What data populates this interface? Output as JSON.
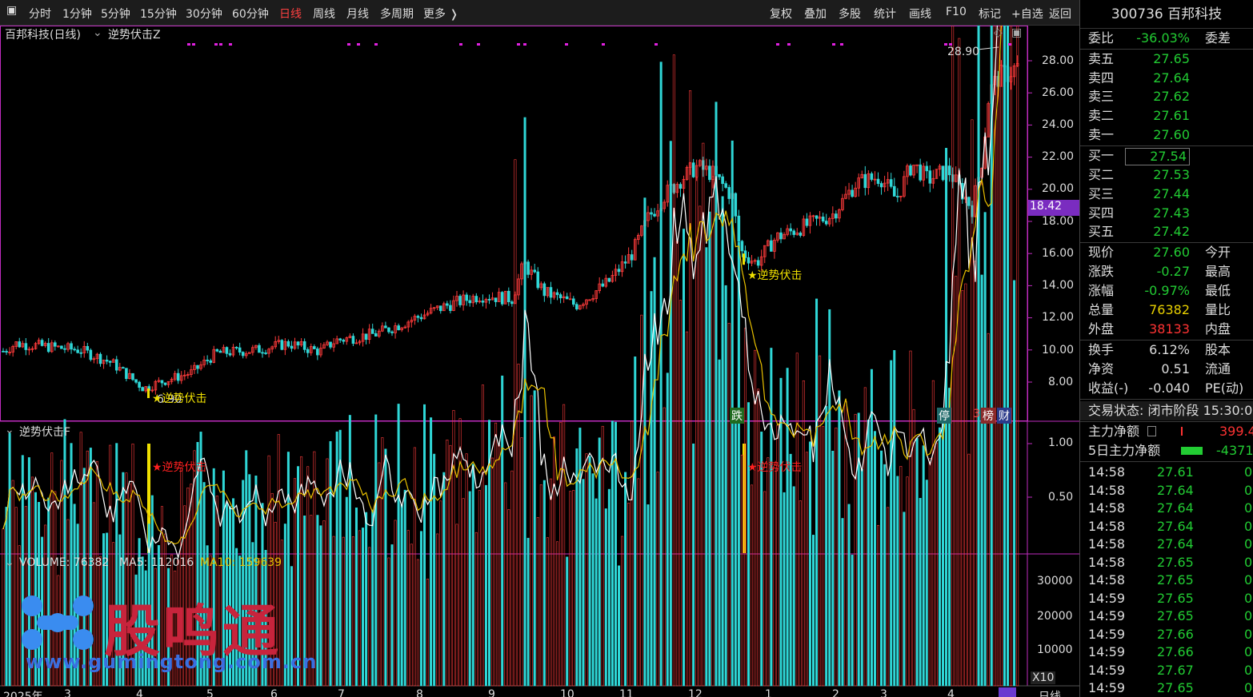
{
  "toolbar": {
    "menu_icon": "menu-icon",
    "periods": [
      "分时",
      "1分钟",
      "5分钟",
      "15分钟",
      "30分钟",
      "60分钟",
      "日线",
      "周线",
      "月线",
      "多周期",
      "更多 ❭"
    ],
    "active_period": "日线",
    "right_buttons": [
      "复权",
      "叠加",
      "多股",
      "统计",
      "画线",
      "F10",
      "标记",
      "+自选",
      "返回"
    ]
  },
  "chart_title": "百邦科技(日线)",
  "indicator_main": "逆势伏击Z",
  "indicator_sub": "逆势伏击F",
  "signal_label": "★逆势伏击",
  "high_label": "28.90",
  "low_label": "6.90",
  "current_price_tag": "18.42",
  "price_axis": [
    "28.00",
    "26.00",
    "24.00",
    "22.00",
    "20.00",
    "18.00",
    "16.00",
    "14.00",
    "12.00",
    "10.00",
    "8.00"
  ],
  "sub_axis": [
    "1.00",
    "0.50"
  ],
  "volume_axis": [
    "30000",
    "20000",
    "10000"
  ],
  "volume_scale": "X10",
  "volume_legend": {
    "vol": "VOLUME: 76382",
    "ma5": "MA5: 112016",
    "ma10": "MA10: 159639"
  },
  "date_axis": [
    "2025年",
    "3",
    "4",
    "5",
    "6",
    "7",
    "8",
    "9",
    "10",
    "11",
    "12",
    "1",
    "2",
    "3",
    "4"
  ],
  "period_footer": "日线",
  "markers": {
    "die": "跌",
    "ting": "停",
    "bang": "榜",
    "cai": "财"
  },
  "watermark": {
    "cn": "股鸣通",
    "url": "www.gumingtong.com.cn"
  },
  "quote": {
    "title": "300736 百邦科技",
    "weibi_label": "委比",
    "weibi_value": "-36.03%",
    "weicha_label": "委差",
    "asks": [
      {
        "label": "卖五",
        "price": "27.65"
      },
      {
        "label": "卖四",
        "price": "27.64"
      },
      {
        "label": "卖三",
        "price": "27.62"
      },
      {
        "label": "卖二",
        "price": "27.61"
      },
      {
        "label": "卖一",
        "price": "27.60"
      }
    ],
    "bids": [
      {
        "label": "买一",
        "price": "27.54"
      },
      {
        "label": "买二",
        "price": "27.53"
      },
      {
        "label": "买三",
        "price": "27.44"
      },
      {
        "label": "买四",
        "price": "27.43"
      },
      {
        "label": "买五",
        "price": "27.42"
      }
    ],
    "stats": [
      {
        "a": "现价",
        "b": "27.60",
        "c": "今开",
        "color": "green"
      },
      {
        "a": "涨跌",
        "b": "-0.27",
        "c": "最高",
        "color": "green"
      },
      {
        "a": "涨幅",
        "b": "-0.97%",
        "c": "最低",
        "color": "green"
      },
      {
        "a": "总量",
        "b": "76382",
        "c": "量比",
        "color": "yellow"
      },
      {
        "a": "外盘",
        "b": "38133",
        "c": "内盘",
        "color": "red"
      }
    ],
    "stats2": [
      {
        "a": "换手",
        "b": "6.12%",
        "c": "股本"
      },
      {
        "a": "净资",
        "b": "0.51",
        "c": "流通"
      },
      {
        "a": "收益(-)",
        "b": "-0.040",
        "c": "PE(动)"
      }
    ],
    "trade_status": "交易状态: 闭市阶段 15:30:0",
    "main_net_label": "主力净额",
    "main_net_value": "399.4",
    "main_net5_label": "5日主力净额",
    "main_net5_value": "-4371",
    "ticks": [
      {
        "t": "14:58",
        "p": "27.61",
        "v": "0"
      },
      {
        "t": "14:58",
        "p": "27.64",
        "v": "0"
      },
      {
        "t": "14:58",
        "p": "27.64",
        "v": "0"
      },
      {
        "t": "14:58",
        "p": "27.64",
        "v": "0"
      },
      {
        "t": "14:58",
        "p": "27.64",
        "v": "0"
      },
      {
        "t": "14:58",
        "p": "27.65",
        "v": "0"
      },
      {
        "t": "14:58",
        "p": "27.65",
        "v": "0"
      },
      {
        "t": "14:59",
        "p": "27.65",
        "v": "0"
      },
      {
        "t": "14:59",
        "p": "27.65",
        "v": "0"
      },
      {
        "t": "14:59",
        "p": "27.66",
        "v": "0"
      },
      {
        "t": "14:59",
        "p": "27.66",
        "v": "0"
      },
      {
        "t": "14:59",
        "p": "27.67",
        "v": "0"
      },
      {
        "t": "14:59",
        "p": "27.65",
        "v": "0"
      }
    ]
  },
  "colors": {
    "up": "#ff3b3b",
    "down": "#2fd7d7",
    "signal": "#f0e000",
    "accent": "#c02cc0",
    "ma_white": "#ffffff",
    "ma_yellow": "#e8c000"
  }
}
